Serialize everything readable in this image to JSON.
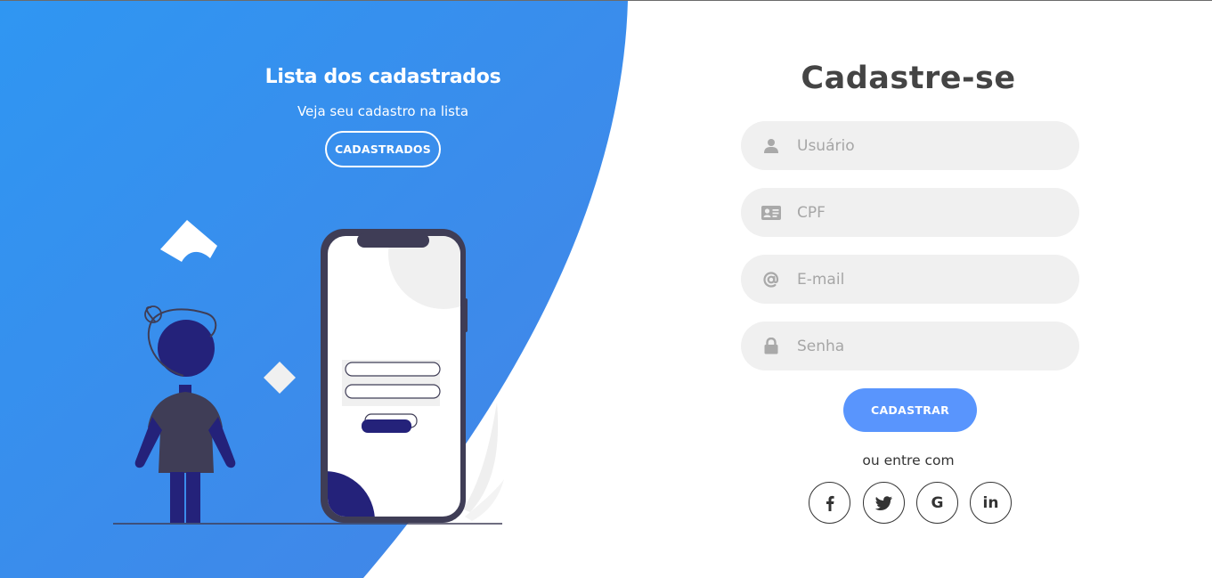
{
  "colors": {
    "panel_gradient_start": "#2f96f2",
    "panel_gradient_end": "#3f85e8",
    "accent_button": "#5995fd",
    "input_background": "#f0f0f0",
    "illustration_dark": "#3f3d56",
    "illustration_navy": "#24227a"
  },
  "left_panel": {
    "title": "Lista dos cadastrados",
    "subtitle": "Veja seu cadastro na lista",
    "button_label": "CADASTRADOS"
  },
  "form": {
    "title": "Cadastre-se",
    "fields": [
      {
        "icon": "user-icon",
        "placeholder": "Usuário"
      },
      {
        "icon": "id-card-icon",
        "placeholder": "CPF"
      },
      {
        "icon": "at-sign-icon",
        "placeholder": "E-mail"
      },
      {
        "icon": "lock-icon",
        "placeholder": "Senha"
      }
    ],
    "submit_label": "CADASTRAR",
    "social_text": "ou entre com",
    "social_icons": [
      "facebook-icon",
      "twitter-icon",
      "google-icon",
      "linkedin-icon"
    ],
    "social_glyphs": {
      "google": "G",
      "linkedin": "in"
    }
  }
}
